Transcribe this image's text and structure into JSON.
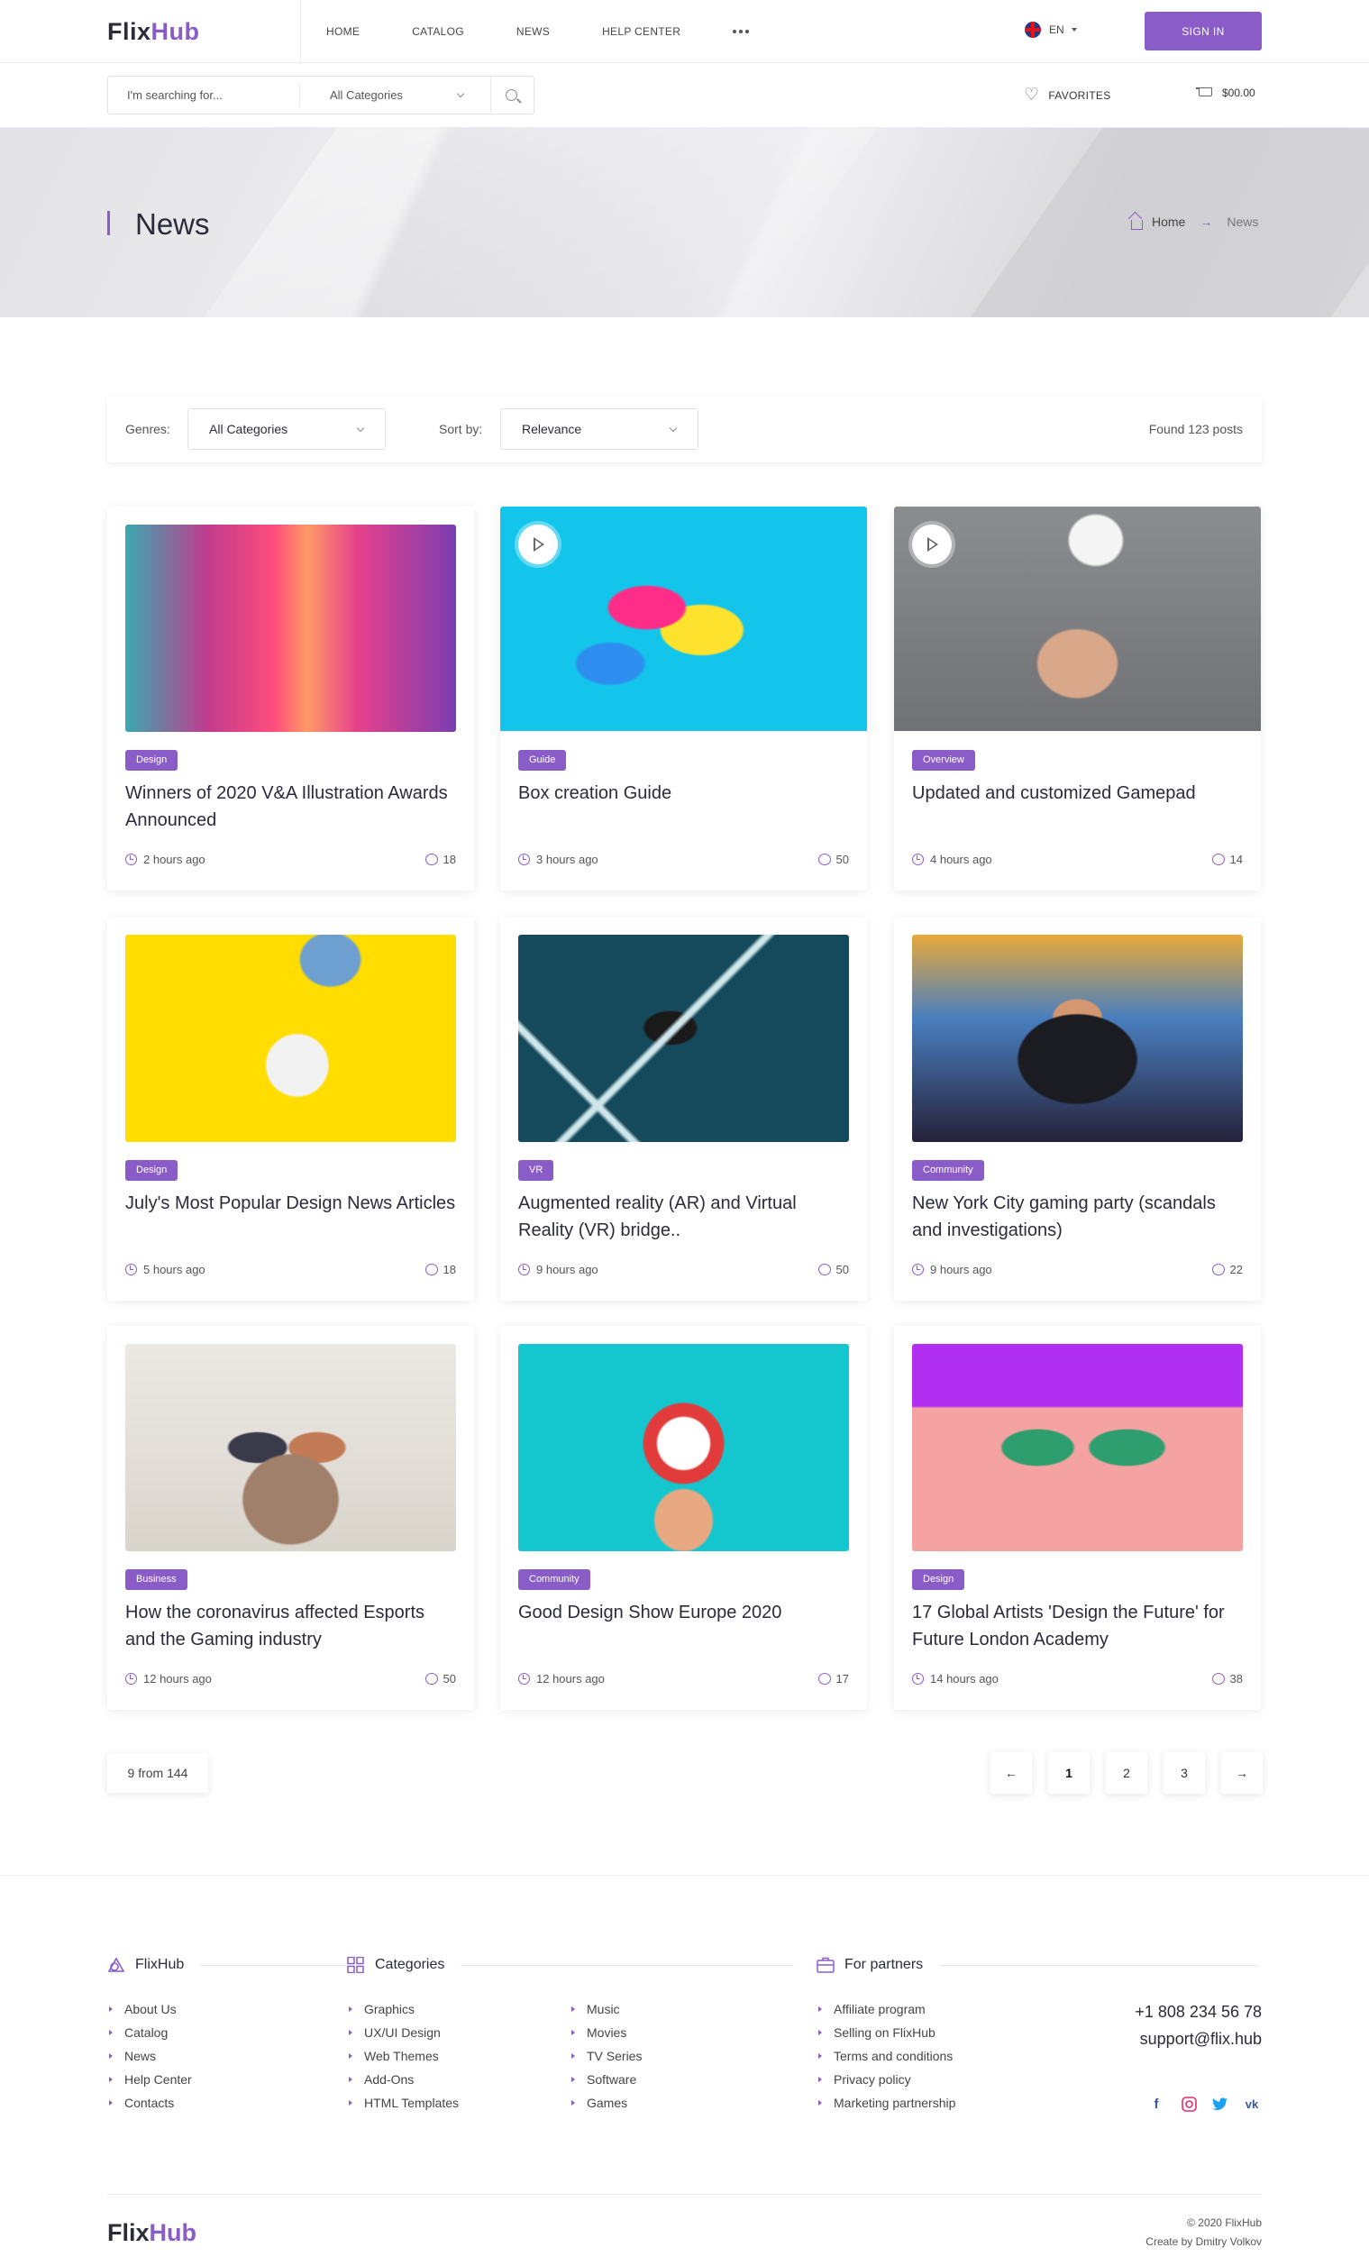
{
  "brand": {
    "logo_a": "Flix",
    "logo_b": "Hub"
  },
  "nav": {
    "items": [
      "HOME",
      "CATALOG",
      "NEWS",
      "HELP CENTER"
    ],
    "language": "EN",
    "signin": "SIGN IN"
  },
  "search": {
    "placeholder": "I'm searching for...",
    "category": "All Categories",
    "favorites": "FAVORITES",
    "cart_total": "$00.00"
  },
  "hero": {
    "title": "News",
    "breadcrumb": [
      "Home",
      "News"
    ]
  },
  "filter": {
    "genres_label": "Genres:",
    "genres_value": "All Categories",
    "sort_label": "Sort by:",
    "sort_value": "Relevance",
    "found": "Found 123 posts"
  },
  "posts": [
    {
      "tag": "Design",
      "title": "Winners of 2020 V&A Illustration Awards Announced",
      "time": "2 hours ago",
      "comments": "18",
      "image": "neon-corridor",
      "video": false
    },
    {
      "tag": "Guide",
      "title": "Box creation Guide",
      "time": "3 hours ago",
      "comments": "50",
      "image": "colored-boxes",
      "video": true
    },
    {
      "tag": "Overview",
      "title": "Updated and customized Gamepad",
      "time": "4 hours ago",
      "comments": "14",
      "image": "hand-gamepad",
      "video": true
    },
    {
      "tag": "Design",
      "title": "July's Most Popular Design News Articles",
      "time": "5 hours ago",
      "comments": "18",
      "image": "hand-mug-yellow",
      "video": false
    },
    {
      "tag": "VR",
      "title": "Augmented reality (AR) and Virtual Reality (VR) bridge..",
      "time": "9 hours ago",
      "comments": "50",
      "image": "vr-person",
      "video": false
    },
    {
      "tag": "Community",
      "title": "New York City gaming party (scandals and investigations)",
      "time": "9 hours ago",
      "comments": "22",
      "image": "neon-girl",
      "video": false
    },
    {
      "tag": "Business",
      "title": "How the coronavirus affected Esports and the Gaming industry",
      "time": "12 hours ago",
      "comments": "50",
      "image": "couple-gaming",
      "video": false
    },
    {
      "tag": "Community",
      "title": "Good Design Show Europe 2020",
      "time": "12 hours ago",
      "comments": "17",
      "image": "alarm-clock",
      "video": false
    },
    {
      "tag": "Design",
      "title": "17 Global Artists 'Design the Future' for Future London Academy",
      "time": "14 hours ago",
      "comments": "38",
      "image": "sunglasses",
      "video": false
    }
  ],
  "pagination": {
    "count": "9 from 144",
    "pages": [
      "1",
      "2",
      "3"
    ],
    "current": "1"
  },
  "footer": {
    "col1": {
      "title": "FlixHub",
      "items": [
        "About Us",
        "Catalog",
        "News",
        "Help Center",
        "Contacts"
      ]
    },
    "col2": {
      "title": "Categories",
      "items_a": [
        "Graphics",
        "UX/UI Design",
        "Web Themes",
        "Add-Ons",
        "HTML Templates"
      ],
      "items_b": [
        "Music",
        "Movies",
        "TV Series",
        "Software",
        "Games"
      ]
    },
    "col3": {
      "title": "For partners",
      "items": [
        "Affiliate program",
        "Selling on FlixHub",
        "Terms and conditions",
        "Privacy policy",
        "Marketing partnership"
      ]
    },
    "phone": "+1 808 234 56 78",
    "email": "support@flix.hub",
    "social": [
      "facebook-icon",
      "instagram-icon",
      "twitter-icon",
      "vk-icon"
    ],
    "copyright": "© 2020 FlixHub",
    "credit": "Create by Dmitry Volkov"
  },
  "colors": {
    "accent": "#8a5cc7",
    "text": "#2b2b3a"
  }
}
